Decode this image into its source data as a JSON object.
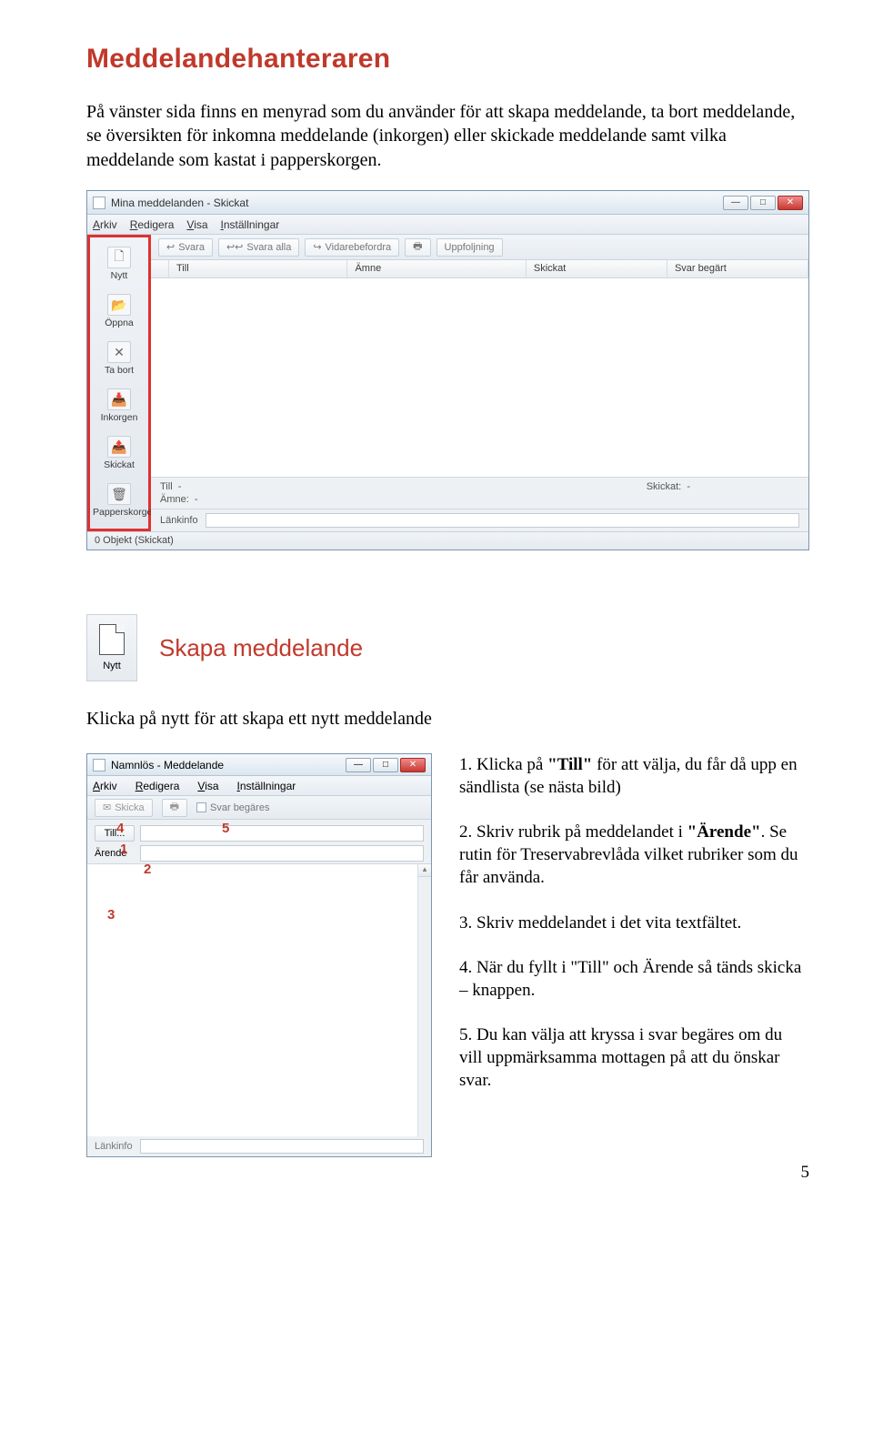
{
  "title": "Meddelandehanteraren",
  "intro": "På vänster sida finns en menyrad som du använder för att skapa meddelande, ta bort meddelande, se översikten för inkomna meddelande (inkorgen) eller skickade meddelande samt vilka meddelande som kastat i papperskorgen.",
  "win1": {
    "title": "Mina meddelanden - Skickat",
    "menus": [
      "Arkiv",
      "Redigera",
      "Visa",
      "Inställningar"
    ],
    "toolbar": [
      "Svara",
      "Svara alla",
      "Vidarebefordra",
      "",
      "Uppfoljning"
    ],
    "side": [
      {
        "label": "Nytt",
        "icon": "doc"
      },
      {
        "label": "Öppna",
        "icon": "open"
      },
      {
        "label": "Ta bort",
        "icon": "x"
      },
      {
        "label": "Inkorgen",
        "icon": "inbox"
      },
      {
        "label": "Skickat",
        "icon": "sent"
      },
      {
        "label": "Papperskorgen",
        "icon": "trash"
      }
    ],
    "cols": [
      "Till",
      "Ämne",
      "Skickat",
      "Svar begärt"
    ],
    "detail": {
      "till": "Till",
      "amne": "Ämne:",
      "skickat": "Skickat:",
      "dash": "-"
    },
    "linkinfo": "Länkinfo",
    "status": "0 Objekt (Skickat)"
  },
  "nytt_label": "Nytt",
  "sub_heading": "Skapa meddelande",
  "lead": "Klicka på nytt för att skapa ett nytt meddelande",
  "compose": {
    "title": "Namnlös - Meddelande",
    "menus": [
      "Arkiv",
      "Redigera",
      "Visa",
      "Inställningar"
    ],
    "skicka": "Skicka",
    "svarbeg": "Svar begäres",
    "till": "Till...",
    "arende": "Ärende",
    "linkinfo": "Länkinfo"
  },
  "annot": {
    "a1": "1",
    "a2": "2",
    "a3": "3",
    "a4": "4",
    "a5": "5"
  },
  "steps": {
    "s1a": "1. Klicka på ",
    "s1b": "\"Till\"",
    "s1c": " för att välja, du får då upp en sändlista (se nästa bild)",
    "s2a": "2. Skriv rubrik på meddelandet i ",
    "s2b": "\"Ärende\"",
    "s2c": ". Se rutin för Treservabrevlåda vilket rubriker som du får använda.",
    "s3": "3. Skriv meddelandet i det vita textfältet.",
    "s4": "4. När du fyllt i \"Till\" och Ärende så tänds skicka – knappen.",
    "s5": "5. Du kan välja att kryssa i svar begäres om du vill uppmärksamma mottagen på att du önskar svar."
  },
  "page_num": "5"
}
